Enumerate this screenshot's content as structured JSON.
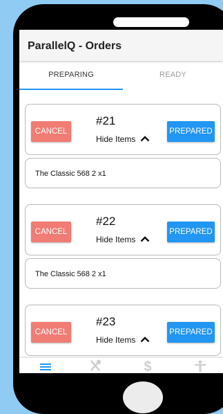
{
  "app": {
    "title": "ParallelQ - Orders"
  },
  "tabs": [
    {
      "label": "PREPARING",
      "active": true
    },
    {
      "label": "READY",
      "active": false
    }
  ],
  "orders": [
    {
      "number": "#21",
      "toggle_label": "Hide Items",
      "cancel_label": "CANCEL",
      "prepared_label": "PREPARED",
      "items": [
        "The Classic 568 2 x1"
      ]
    },
    {
      "number": "#22",
      "toggle_label": "Hide Items",
      "cancel_label": "CANCEL",
      "prepared_label": "PREPARED",
      "items": [
        "The Classic 568 2 x1"
      ]
    },
    {
      "number": "#23",
      "toggle_label": "Hide Items",
      "cancel_label": "CANCEL",
      "prepared_label": "PREPARED",
      "items": []
    }
  ],
  "bottom_nav": [
    {
      "icon": "list-icon",
      "active": true
    },
    {
      "icon": "utensils-icon",
      "active": false
    },
    {
      "icon": "dollar-icon",
      "active": false
    },
    {
      "icon": "accessibility-icon",
      "active": false
    }
  ],
  "colors": {
    "background": "#8fcbf3",
    "primary": "#2196f3",
    "cancel": "#f07c74",
    "inactive_icon": "#cfcfcf"
  }
}
